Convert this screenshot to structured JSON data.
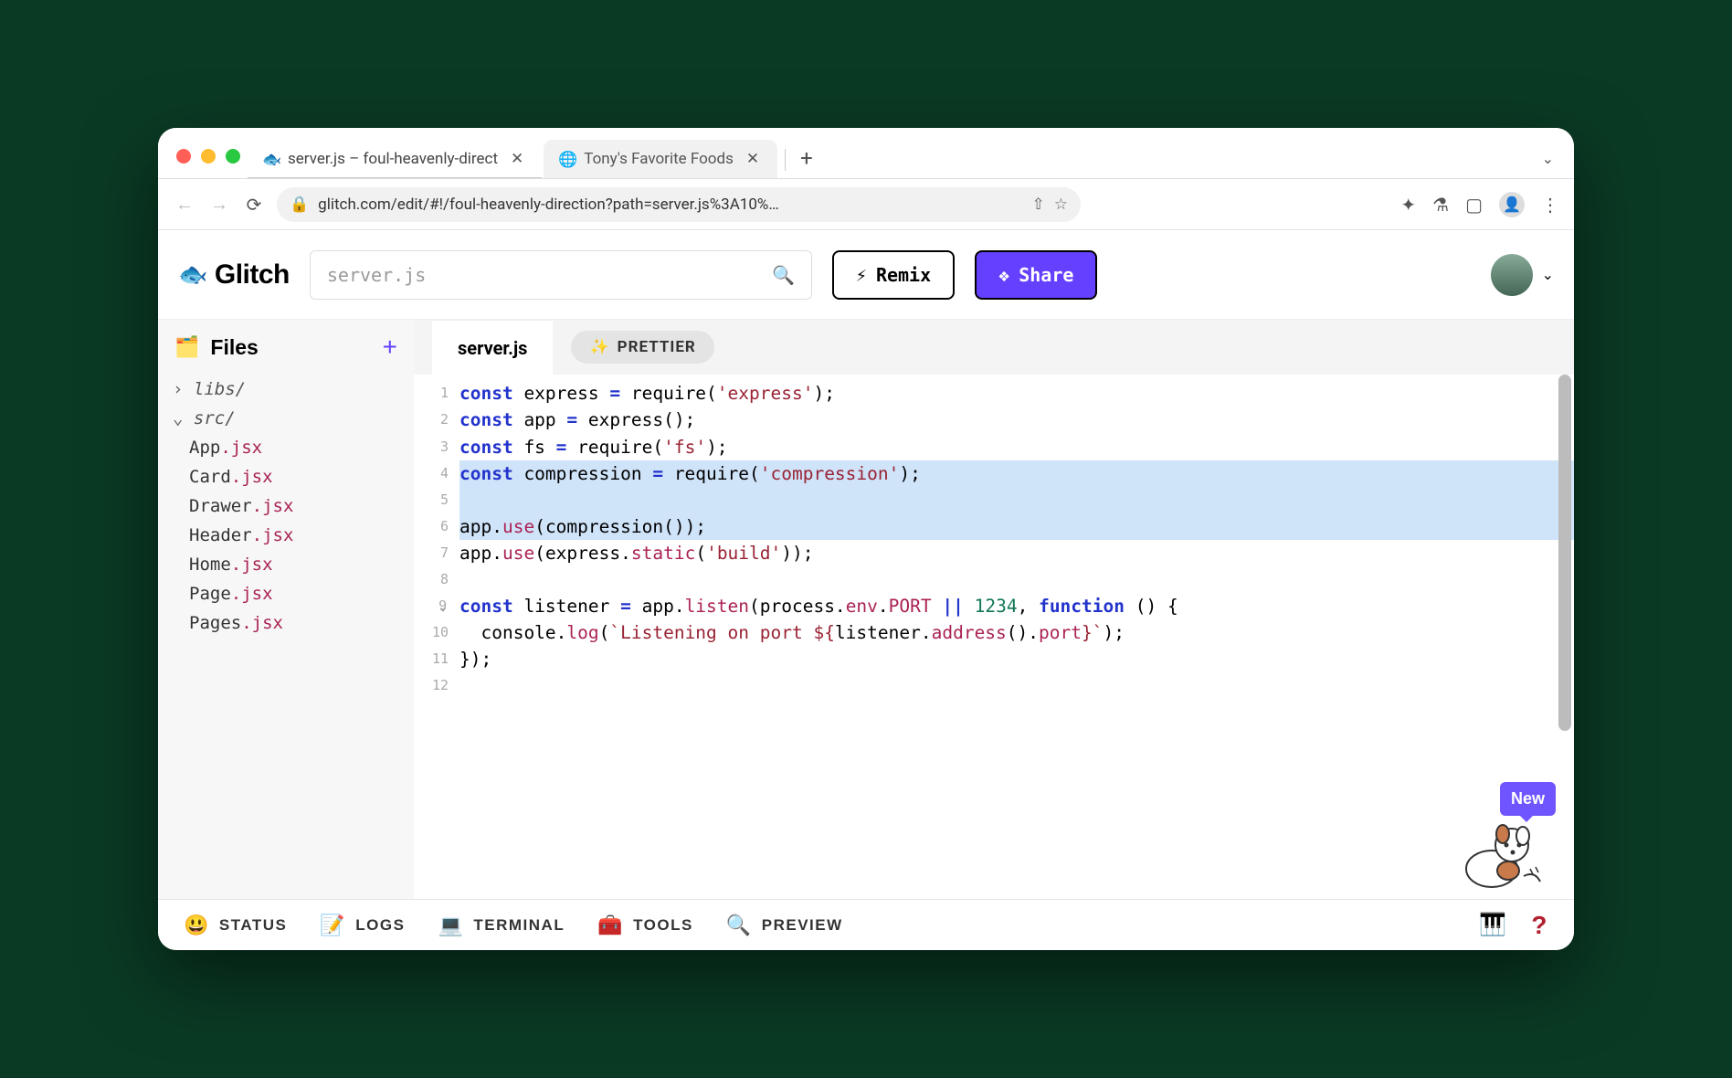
{
  "browser": {
    "tabs": [
      {
        "title": "server.js – foul-heavenly-direct",
        "active": true
      },
      {
        "title": "Tony's Favorite Foods",
        "active": false
      }
    ],
    "url": "glitch.com/edit/#!/foul-heavenly-direction?path=server.js%3A10%…"
  },
  "app": {
    "brand": "Glitch",
    "search_placeholder": "server.js",
    "remix_label": "Remix",
    "share_label": "Share"
  },
  "sidebar": {
    "heading": "Files",
    "folders": [
      {
        "name": "libs/",
        "open": false
      },
      {
        "name": "src/",
        "open": true,
        "files": [
          {
            "base": "App",
            "ext": ".jsx"
          },
          {
            "base": "Card",
            "ext": ".jsx"
          },
          {
            "base": "Drawer",
            "ext": ".jsx"
          },
          {
            "base": "Header",
            "ext": ".jsx"
          },
          {
            "base": "Home",
            "ext": ".jsx"
          },
          {
            "base": "Page",
            "ext": ".jsx"
          },
          {
            "base": "Pages",
            "ext": ".jsx"
          }
        ]
      }
    ]
  },
  "editor": {
    "tab_label": "server.js",
    "prettier_label": "PRETTIER",
    "lines": [
      {
        "n": 1,
        "hl": false,
        "tokens": [
          [
            "kw",
            "const"
          ],
          [
            "",
            " express "
          ],
          [
            "op",
            "="
          ],
          [
            "",
            " require("
          ],
          [
            "str",
            "'express'"
          ],
          [
            "",
            ");"
          ]
        ]
      },
      {
        "n": 2,
        "hl": false,
        "tokens": [
          [
            "kw",
            "const"
          ],
          [
            "",
            " app "
          ],
          [
            "op",
            "="
          ],
          [
            "",
            " express();"
          ]
        ]
      },
      {
        "n": 3,
        "hl": false,
        "tokens": [
          [
            "kw",
            "const"
          ],
          [
            "",
            " fs "
          ],
          [
            "op",
            "="
          ],
          [
            "",
            " require("
          ],
          [
            "str",
            "'fs'"
          ],
          [
            "",
            ");"
          ]
        ]
      },
      {
        "n": 4,
        "hl": true,
        "tokens": [
          [
            "kw",
            "const"
          ],
          [
            "",
            " compression "
          ],
          [
            "op",
            "="
          ],
          [
            "",
            " require("
          ],
          [
            "str",
            "'compression'"
          ],
          [
            "",
            ");"
          ]
        ]
      },
      {
        "n": 5,
        "hl": true,
        "tokens": [
          [
            "",
            ""
          ]
        ]
      },
      {
        "n": 6,
        "hl": true,
        "tokens": [
          [
            "",
            "app."
          ],
          [
            "prop",
            "use"
          ],
          [
            "",
            "(compression());"
          ]
        ]
      },
      {
        "n": 7,
        "hl": false,
        "tokens": [
          [
            "",
            "app."
          ],
          [
            "prop",
            "use"
          ],
          [
            "",
            "(express."
          ],
          [
            "prop",
            "static"
          ],
          [
            "",
            "("
          ],
          [
            "str",
            "'build'"
          ],
          [
            "",
            "));"
          ]
        ]
      },
      {
        "n": 8,
        "hl": false,
        "tokens": [
          [
            "",
            ""
          ]
        ]
      },
      {
        "n": 9,
        "hl": false,
        "fold": true,
        "tokens": [
          [
            "kw",
            "const"
          ],
          [
            "",
            " listener "
          ],
          [
            "op",
            "="
          ],
          [
            "",
            " app."
          ],
          [
            "prop",
            "listen"
          ],
          [
            "",
            "(process."
          ],
          [
            "prop",
            "env"
          ],
          [
            "",
            "."
          ],
          [
            "prop",
            "PORT"
          ],
          [
            "",
            " "
          ],
          [
            "op",
            "||"
          ],
          [
            "",
            " "
          ],
          [
            "num",
            "1234"
          ],
          [
            "",
            ", "
          ],
          [
            "kw",
            "function"
          ],
          [
            "",
            " () {"
          ]
        ]
      },
      {
        "n": 10,
        "hl": false,
        "tokens": [
          [
            "",
            "  console."
          ],
          [
            "prop",
            "log"
          ],
          [
            "",
            "("
          ],
          [
            "str",
            "`Listening on port ${"
          ],
          [
            "",
            "listener."
          ],
          [
            "prop",
            "address"
          ],
          [
            "",
            "()."
          ],
          [
            "prop",
            "port"
          ],
          [
            "str",
            "}`"
          ],
          [
            "",
            ");"
          ]
        ]
      },
      {
        "n": 11,
        "hl": false,
        "tokens": [
          [
            "",
            "});"
          ]
        ]
      },
      {
        "n": 12,
        "hl": false,
        "tokens": [
          [
            "",
            ""
          ]
        ]
      }
    ]
  },
  "mascot": {
    "label": "New"
  },
  "footer": {
    "items": [
      {
        "icon": "😃",
        "label": "STATUS"
      },
      {
        "icon": "📝",
        "label": "LOGS"
      },
      {
        "icon": "💻",
        "label": "TERMINAL"
      },
      {
        "icon": "🧰",
        "label": "TOOLS"
      },
      {
        "icon": "🔍",
        "label": "PREVIEW"
      }
    ]
  }
}
